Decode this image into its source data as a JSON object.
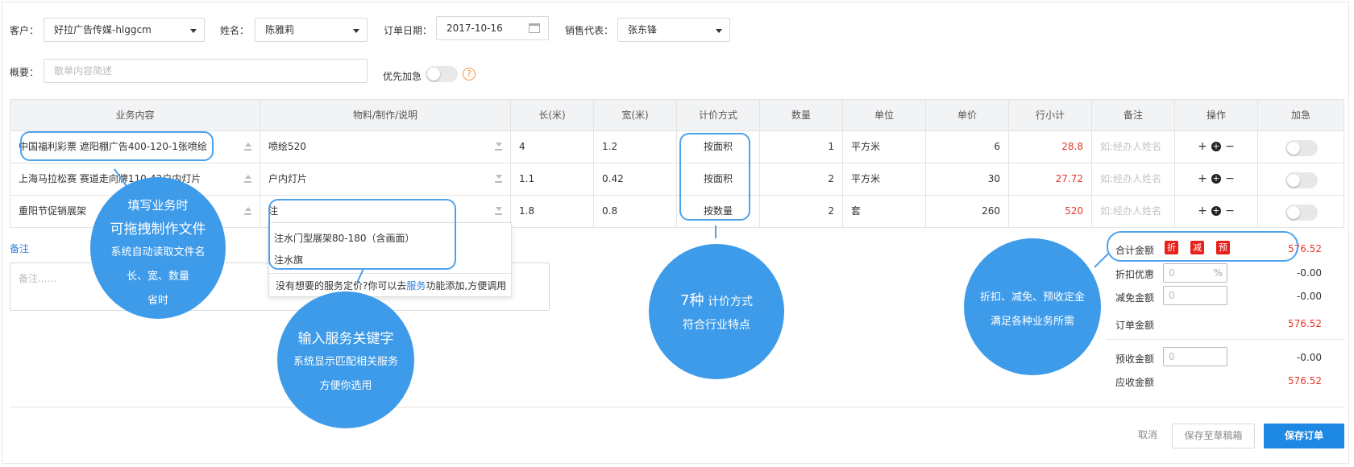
{
  "form": {
    "customer_label": "客户：",
    "customer_value": "好拉广告传媒-hlggcm",
    "name_label": "姓名：",
    "name_value": "陈雅莉",
    "date_label": "订单日期：",
    "date_value": "2017-10-16",
    "rep_label": "销售代表：",
    "rep_value": "张东锋",
    "summary_label": "概要：",
    "summary_placeholder": "散单内容简述",
    "priority_label": "优先加急",
    "priority_on": false,
    "help_glyph": "?"
  },
  "table": {
    "headers": [
      "业务内容",
      "物料/制作/说明",
      "长(米)",
      "宽(米)",
      "计价方式",
      "数量",
      "单位",
      "单价",
      "行小计",
      "备注",
      "操作",
      "加急"
    ],
    "rows": [
      {
        "content": "中国福利彩票 遮阳棚广告400-120-1张喷绘",
        "material": "喷绘520",
        "length": "4",
        "width": "1.2",
        "pricing": "按面积",
        "qty": "1",
        "unit": "平方米",
        "price": "6",
        "subtotal": "28.8",
        "note_placeholder": "如:经办人姓名"
      },
      {
        "content": "上海马拉松赛 赛道走向牌110-42户内灯片",
        "material": "户内灯片",
        "length": "1.1",
        "width": "0.42",
        "pricing": "按面积",
        "qty": "2",
        "unit": "平方米",
        "price": "30",
        "subtotal": "27.72",
        "note_placeholder": "如:经办人姓名"
      },
      {
        "content": "重阳节促销展架",
        "material": "注",
        "length": "1.8",
        "width": "0.8",
        "pricing": "按数量",
        "qty": "2",
        "unit": "套",
        "price": "260",
        "subtotal": "520",
        "note_placeholder": "如:经办人姓名"
      }
    ],
    "op_plus": "+",
    "op_add_circle": "+",
    "op_minus": "−"
  },
  "dropdown": {
    "items": [
      "注水门型展架80-180（含画面）",
      "注水旗"
    ],
    "footer_pre": "没有想要的服务定价?你可以去",
    "footer_link": "服务",
    "footer_post": "功能添加,方便调用"
  },
  "memo": {
    "label": "备注",
    "placeholder": "备注......"
  },
  "summary": {
    "total_label": "合计金额",
    "badges": [
      "折",
      "减",
      "预"
    ],
    "total_value": "576.52",
    "discount_label": "折扣优惠",
    "discount_input": "0",
    "discount_unit": "%",
    "discount_value": "-0.00",
    "reduce_label": "减免金额",
    "reduce_input": "0",
    "reduce_value": "-0.00",
    "order_label": "订单金额",
    "order_value": "576.52",
    "prepay_label": "预收金额",
    "prepay_input": "0",
    "prepay_value": "-0.00",
    "receivable_label": "应收金额",
    "receivable_value": "576.52"
  },
  "actions": {
    "cancel": "取消",
    "draft": "保存至草稿箱",
    "save": "保存订单"
  },
  "callouts": {
    "c1": [
      "填写业务时",
      "可拖拽制作文件",
      "系统自动读取文件名",
      "长、宽、数量",
      "省时"
    ],
    "c2": [
      "输入服务关键字",
      "系统显示匹配相关服务",
      "方便你选用"
    ],
    "c3_big": "7种",
    "c3_rest": " 计价方式",
    "c3_line2": "符合行业特点",
    "c4": [
      "折扣、减免、预收定金",
      "满足各种业务所需"
    ]
  },
  "colors": {
    "accent": "#1e88e5",
    "callout": "#3d9be9",
    "red": "#e8382b"
  }
}
